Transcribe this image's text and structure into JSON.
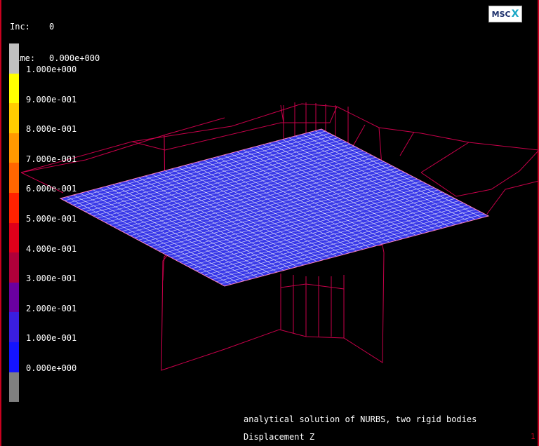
{
  "hud": {
    "inc_label": "Inc:",
    "inc_value": "0",
    "time_label": "Time:",
    "time_value": "0.000e+000"
  },
  "logo": {
    "text": "MSC",
    "mark": "X"
  },
  "legend": {
    "labels": [
      "1.000e+000",
      "9.000e-001",
      "8.000e-001",
      "7.000e-001",
      "6.000e-001",
      "5.000e-001",
      "4.000e-001",
      "3.000e-001",
      "2.000e-001",
      "1.000e-001",
      "0.000e+000"
    ],
    "colors": [
      "#c0c0c0",
      "#ffff00",
      "#ffcc00",
      "#ff9900",
      "#ff6600",
      "#ff2200",
      "#e0001a",
      "#b0003a",
      "#6a00a0",
      "#3a1ee0",
      "#1414ff",
      "#808080"
    ]
  },
  "caption": "analytical solution of NURBS, two rigid bodies",
  "quantity": "Displacement Z",
  "corner_mark": "1",
  "colors": {
    "background": "#000000",
    "wire": "#c8004a",
    "plate": "#3838e8",
    "mesh": "#ffffff",
    "frame": "#c8001e"
  }
}
